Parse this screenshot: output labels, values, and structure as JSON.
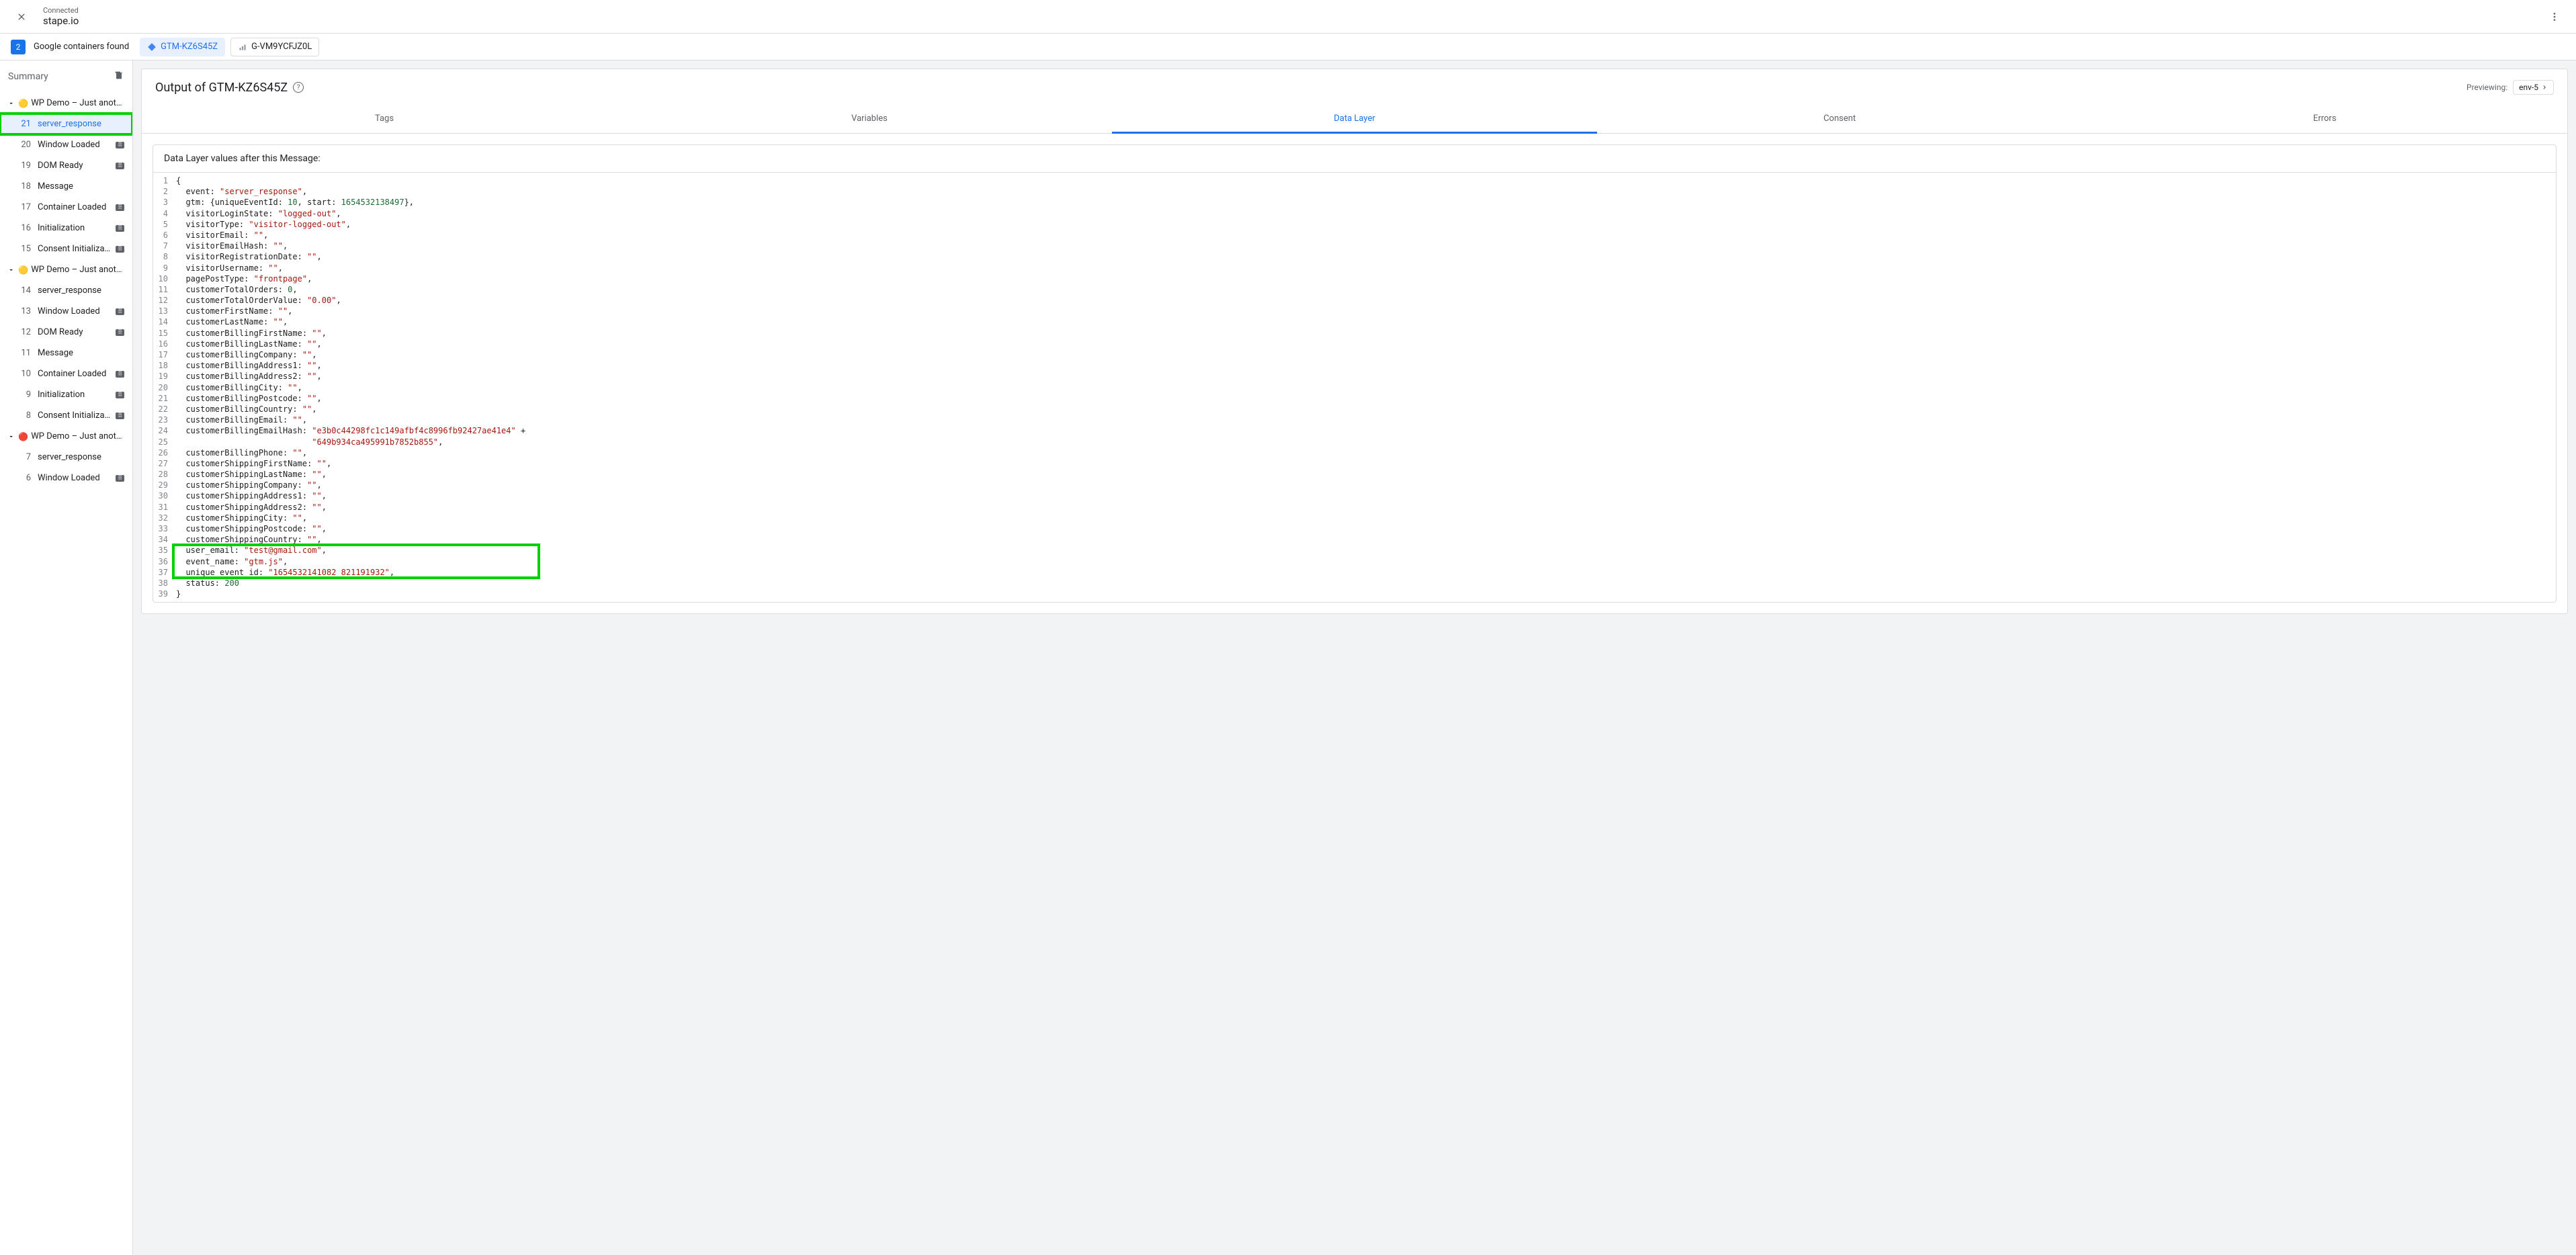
{
  "header": {
    "connected": "Connected",
    "host": "stape.io"
  },
  "subbar": {
    "count": "2",
    "found": "Google containers found",
    "pills": [
      {
        "id": "GTM-KZ6S45Z",
        "active": true,
        "type": "gtm"
      },
      {
        "id": "G-VM9YCFJZ0L",
        "active": false,
        "type": "ga"
      }
    ]
  },
  "sidebar": {
    "title": "Summary",
    "groups": [
      {
        "dot": "🟡",
        "name": "WP Demo – Just anothe…",
        "events": [
          {
            "n": "21",
            "label": "server_response",
            "dl": false,
            "sel": true,
            "hl": true
          },
          {
            "n": "20",
            "label": "Window Loaded",
            "dl": true
          },
          {
            "n": "19",
            "label": "DOM Ready",
            "dl": true
          },
          {
            "n": "18",
            "label": "Message",
            "dl": false
          },
          {
            "n": "17",
            "label": "Container Loaded",
            "dl": true
          },
          {
            "n": "16",
            "label": "Initialization",
            "dl": true
          },
          {
            "n": "15",
            "label": "Consent Initialization",
            "dl": true
          }
        ]
      },
      {
        "dot": "🟡",
        "name": "WP Demo – Just anothe…",
        "events": [
          {
            "n": "14",
            "label": "server_response",
            "dl": false
          },
          {
            "n": "13",
            "label": "Window Loaded",
            "dl": true
          },
          {
            "n": "12",
            "label": "DOM Ready",
            "dl": true
          },
          {
            "n": "11",
            "label": "Message",
            "dl": false
          },
          {
            "n": "10",
            "label": "Container Loaded",
            "dl": true
          },
          {
            "n": "9",
            "label": "Initialization",
            "dl": true
          },
          {
            "n": "8",
            "label": "Consent Initialization",
            "dl": true
          }
        ]
      },
      {
        "dot": "🔴",
        "name": "WP Demo – Just anothe…",
        "events": [
          {
            "n": "7",
            "label": "server_response",
            "dl": false
          },
          {
            "n": "6",
            "label": "Window Loaded",
            "dl": true
          }
        ]
      }
    ]
  },
  "panel": {
    "title": "Output of GTM-KZ6S45Z",
    "preview_lbl": "Previewing:",
    "env": "env-5",
    "tabs": [
      "Tags",
      "Variables",
      "Data Layer",
      "Consent",
      "Errors"
    ],
    "active_tab": 2,
    "section_title": "Data Layer values after this Message:",
    "code": [
      [
        {
          "t": "{"
        }
      ],
      [
        {
          "t": "  event: "
        },
        {
          "t": "\"server_response\"",
          "c": "s"
        },
        {
          "t": ","
        }
      ],
      [
        {
          "t": "  gtm: {uniqueEventId: "
        },
        {
          "t": "10",
          "c": "nbr"
        },
        {
          "t": ", start: "
        },
        {
          "t": "1654532138497",
          "c": "nbr"
        },
        {
          "t": "},"
        }
      ],
      [
        {
          "t": "  visitorLoginState: "
        },
        {
          "t": "\"logged-out\"",
          "c": "s"
        },
        {
          "t": ","
        }
      ],
      [
        {
          "t": "  visitorType: "
        },
        {
          "t": "\"visitor-logged-out\"",
          "c": "s"
        },
        {
          "t": ","
        }
      ],
      [
        {
          "t": "  visitorEmail: "
        },
        {
          "t": "\"\"",
          "c": "s"
        },
        {
          "t": ","
        }
      ],
      [
        {
          "t": "  visitorEmailHash: "
        },
        {
          "t": "\"\"",
          "c": "s"
        },
        {
          "t": ","
        }
      ],
      [
        {
          "t": "  visitorRegistrationDate: "
        },
        {
          "t": "\"\"",
          "c": "s"
        },
        {
          "t": ","
        }
      ],
      [
        {
          "t": "  visitorUsername: "
        },
        {
          "t": "\"\"",
          "c": "s"
        },
        {
          "t": ","
        }
      ],
      [
        {
          "t": "  pagePostType: "
        },
        {
          "t": "\"frontpage\"",
          "c": "s"
        },
        {
          "t": ","
        }
      ],
      [
        {
          "t": "  customerTotalOrders: "
        },
        {
          "t": "0",
          "c": "nbr"
        },
        {
          "t": ","
        }
      ],
      [
        {
          "t": "  customerTotalOrderValue: "
        },
        {
          "t": "\"0.00\"",
          "c": "s"
        },
        {
          "t": ","
        }
      ],
      [
        {
          "t": "  customerFirstName: "
        },
        {
          "t": "\"\"",
          "c": "s"
        },
        {
          "t": ","
        }
      ],
      [
        {
          "t": "  customerLastName: "
        },
        {
          "t": "\"\"",
          "c": "s"
        },
        {
          "t": ","
        }
      ],
      [
        {
          "t": "  customerBillingFirstName: "
        },
        {
          "t": "\"\"",
          "c": "s"
        },
        {
          "t": ","
        }
      ],
      [
        {
          "t": "  customerBillingLastName: "
        },
        {
          "t": "\"\"",
          "c": "s"
        },
        {
          "t": ","
        }
      ],
      [
        {
          "t": "  customerBillingCompany: "
        },
        {
          "t": "\"\"",
          "c": "s"
        },
        {
          "t": ","
        }
      ],
      [
        {
          "t": "  customerBillingAddress1: "
        },
        {
          "t": "\"\"",
          "c": "s"
        },
        {
          "t": ","
        }
      ],
      [
        {
          "t": "  customerBillingAddress2: "
        },
        {
          "t": "\"\"",
          "c": "s"
        },
        {
          "t": ","
        }
      ],
      [
        {
          "t": "  customerBillingCity: "
        },
        {
          "t": "\"\"",
          "c": "s"
        },
        {
          "t": ","
        }
      ],
      [
        {
          "t": "  customerBillingPostcode: "
        },
        {
          "t": "\"\"",
          "c": "s"
        },
        {
          "t": ","
        }
      ],
      [
        {
          "t": "  customerBillingCountry: "
        },
        {
          "t": "\"\"",
          "c": "s"
        },
        {
          "t": ","
        }
      ],
      [
        {
          "t": "  customerBillingEmail: "
        },
        {
          "t": "\"\"",
          "c": "s"
        },
        {
          "t": ","
        }
      ],
      [
        {
          "t": "  customerBillingEmailHash: "
        },
        {
          "t": "\"e3b0c44298fc1c149afbf4c8996fb92427ae41e4\"",
          "c": "s"
        },
        {
          "t": " +"
        }
      ],
      [
        {
          "t": "                            "
        },
        {
          "t": "\"649b934ca495991b7852b855\"",
          "c": "s"
        },
        {
          "t": ","
        }
      ],
      [
        {
          "t": "  customerBillingPhone: "
        },
        {
          "t": "\"\"",
          "c": "s"
        },
        {
          "t": ","
        }
      ],
      [
        {
          "t": "  customerShippingFirstName: "
        },
        {
          "t": "\"\"",
          "c": "s"
        },
        {
          "t": ","
        }
      ],
      [
        {
          "t": "  customerShippingLastName: "
        },
        {
          "t": "\"\"",
          "c": "s"
        },
        {
          "t": ","
        }
      ],
      [
        {
          "t": "  customerShippingCompany: "
        },
        {
          "t": "\"\"",
          "c": "s"
        },
        {
          "t": ","
        }
      ],
      [
        {
          "t": "  customerShippingAddress1: "
        },
        {
          "t": "\"\"",
          "c": "s"
        },
        {
          "t": ","
        }
      ],
      [
        {
          "t": "  customerShippingAddress2: "
        },
        {
          "t": "\"\"",
          "c": "s"
        },
        {
          "t": ","
        }
      ],
      [
        {
          "t": "  customerShippingCity: "
        },
        {
          "t": "\"\"",
          "c": "s"
        },
        {
          "t": ","
        }
      ],
      [
        {
          "t": "  customerShippingPostcode: "
        },
        {
          "t": "\"\"",
          "c": "s"
        },
        {
          "t": ","
        }
      ],
      [
        {
          "t": "  customerShippingCountry: "
        },
        {
          "t": "\"\"",
          "c": "s"
        },
        {
          "t": ","
        }
      ],
      [
        {
          "t": "  user_email: "
        },
        {
          "t": "\"test@gmail.com\"",
          "c": "s"
        },
        {
          "t": ","
        }
      ],
      [
        {
          "t": "  event_name: "
        },
        {
          "t": "\"gtm.js\"",
          "c": "s"
        },
        {
          "t": ","
        }
      ],
      [
        {
          "t": "  unique_event_id: "
        },
        {
          "t": "\"1654532141082_821191932\"",
          "c": "s"
        },
        {
          "t": ","
        }
      ],
      [
        {
          "t": "  status: "
        },
        {
          "t": "200",
          "c": "nbr"
        }
      ],
      [
        {
          "t": "}"
        }
      ]
    ]
  }
}
